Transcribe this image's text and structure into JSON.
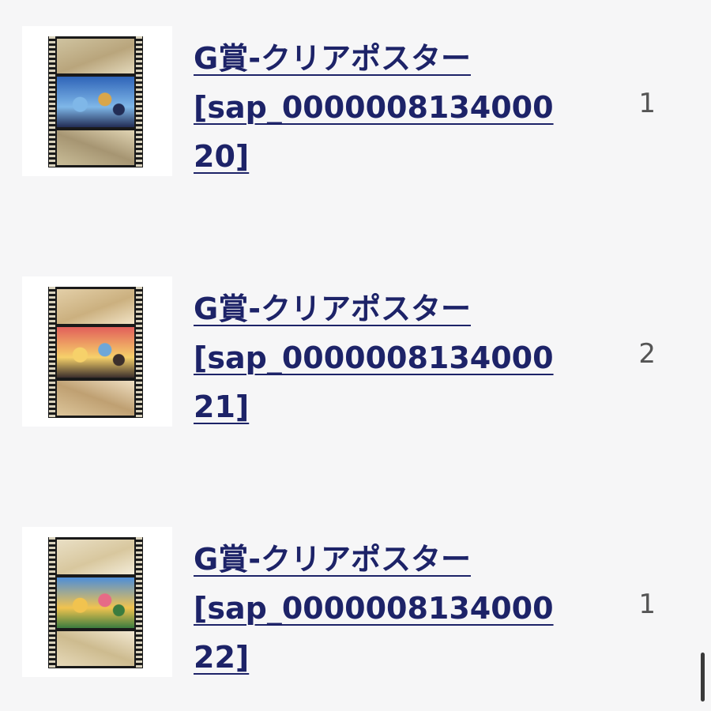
{
  "items": [
    {
      "title_line1": "G賞-クリアポスター",
      "title_line2": "[sap_0000008134000",
      "title_line3": "20]",
      "quantity": "1",
      "thumbnail_palette": {
        "top": [
          "#cfc3a0",
          "#b9a57c",
          "#e3d9bc"
        ],
        "mid": [
          "#2f64b8",
          "#7fb7e8",
          "#d9a64a",
          "#222d55"
        ],
        "bot": [
          "#c9bd98",
          "#a69572",
          "#e0d4b3"
        ]
      }
    },
    {
      "title_line1": "G賞-クリアポスター",
      "title_line2": "[sap_0000008134000",
      "title_line3": "21]",
      "quantity": "2",
      "thumbnail_palette": {
        "top": [
          "#e3cfa8",
          "#cbb07f",
          "#f1e3c6"
        ],
        "mid": [
          "#e25f5a",
          "#f6d16a",
          "#6ea7d8",
          "#3b2f2c"
        ],
        "bot": [
          "#dcc59a",
          "#bfa072",
          "#efdfc2"
        ]
      }
    },
    {
      "title_line1": "G賞-クリアポスター",
      "title_line2": "[sap_0000008134000",
      "title_line3": "22]",
      "quantity": "1",
      "thumbnail_palette": {
        "top": [
          "#e9dfc5",
          "#d8c79e",
          "#f3ecd9"
        ],
        "mid": [
          "#4d8ed8",
          "#f1c34f",
          "#e66b86",
          "#3b7c3f"
        ],
        "bot": [
          "#e6d9b9",
          "#cdbb8f",
          "#f2e8d2"
        ]
      }
    }
  ]
}
